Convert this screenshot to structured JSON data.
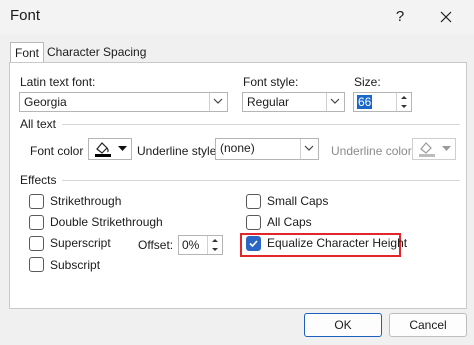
{
  "window": {
    "title": "Font",
    "help": "?"
  },
  "tabs": [
    {
      "label": "Font",
      "active": true
    },
    {
      "label": "Character Spacing",
      "active": false
    }
  ],
  "font_row": {
    "latin_label": "Latin text font:",
    "latin_value": "Georgia",
    "style_label": "Font style:",
    "style_value": "Regular",
    "size_label": "Size:",
    "size_value": "66"
  },
  "all_text": {
    "heading": "All text",
    "font_color_label": "Font color",
    "underline_style_label": "Underline style",
    "underline_style_value": "(none)",
    "underline_color_label": "Underline color"
  },
  "effects": {
    "heading": "Effects",
    "strikethrough": {
      "label": "Strikethrough",
      "checked": false
    },
    "double_strikethrough": {
      "label": "Double Strikethrough",
      "checked": false
    },
    "superscript": {
      "label": "Superscript",
      "checked": false
    },
    "subscript": {
      "label": "Subscript",
      "checked": false
    },
    "offset_label": "Offset:",
    "offset_value": "0%",
    "small_caps": {
      "label": "Small Caps",
      "checked": false
    },
    "all_caps": {
      "label": "All Caps",
      "checked": false
    },
    "equalize": {
      "label": "Equalize Character Height",
      "checked": true
    }
  },
  "buttons": {
    "ok": "OK",
    "cancel": "Cancel"
  },
  "colors": {
    "accent": "#2b66c4",
    "highlight": "#e3262b"
  }
}
